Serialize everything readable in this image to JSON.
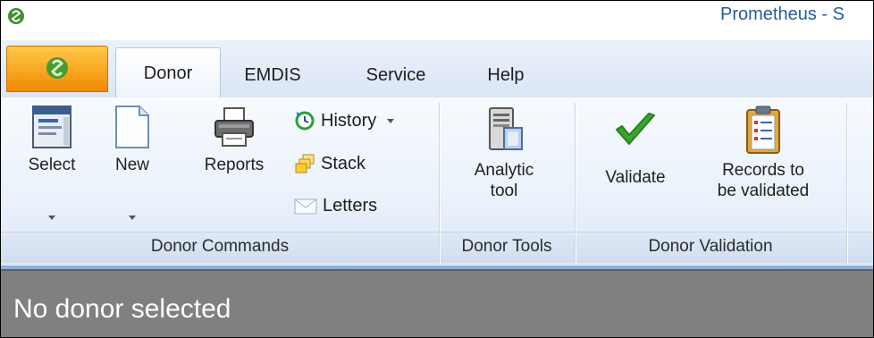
{
  "window": {
    "title": "Prometheus - S"
  },
  "tabs": [
    {
      "label": "Donor",
      "active": true
    },
    {
      "label": "EMDIS",
      "active": false
    },
    {
      "label": "Service",
      "active": false
    },
    {
      "label": "Help",
      "active": false
    }
  ],
  "ribbon": {
    "donor_commands": {
      "label": "Donor Commands",
      "select": "Select",
      "new": "New",
      "reports": "Reports",
      "history": "History",
      "stack": "Stack",
      "letters": "Letters"
    },
    "donor_tools": {
      "label": "Donor Tools",
      "analytic_line1": "Analytic",
      "analytic_line2": "tool"
    },
    "donor_validation": {
      "label": "Donor Validation",
      "validate": "Validate",
      "records_line1": "Records to",
      "records_line2": "be validated"
    }
  },
  "status": {
    "text": "No donor selected"
  },
  "colors": {
    "accent_orange": "#f08a00",
    "ribbon_blue": "#dfe9f5",
    "status_gray": "#808080",
    "check_green": "#3aa52e"
  }
}
